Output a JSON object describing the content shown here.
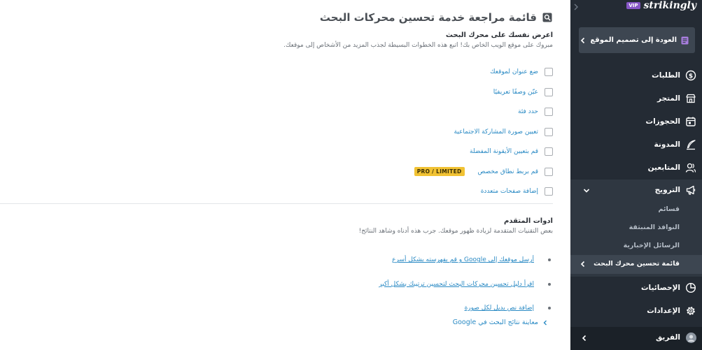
{
  "main": {
    "title": "قائمة مراجعة خدمة تحسين محركات البحث",
    "intro_heading": "اعرض نفسك على محرك البحث",
    "intro_desc": "مبروك على موقع الويب الخاص بك! اتبع هذه الخطوات البسيطة لجذب المزيد من الأشخاص إلى موقعك.",
    "checklist": [
      {
        "label": "ضع عنوان لموقعك",
        "checked": false
      },
      {
        "label": "عيّن وصفًا تعريفيًا",
        "checked": false
      },
      {
        "label": "حدد فئة",
        "checked": false
      },
      {
        "label": "تعيين صورة المشاركة الاجتماعية",
        "checked": false
      },
      {
        "label": "قم بتعيين الأيقونة المفضلة",
        "checked": false
      },
      {
        "label": "قم بربط نطاق مخصص",
        "checked": false,
        "badge": "PRO / LIMITED"
      },
      {
        "label": "إضافة صفحات متعددة",
        "checked": false
      }
    ],
    "advanced_heading": "ادوات المتقدم",
    "advanced_desc": "بعض التقنيات المتقدمة لزيادة ظهور موقعك. جرب هذه أدناه وشاهد النتائج!",
    "advanced_links": [
      "أرسل موقعك إلى Google و قم بفهرسته بشكل أسرع",
      "اقرأ دليل تحسين محركات البحث لتحسين ترتيبك بشكل أكبر",
      "إضافة نص بديل لكل صورة"
    ],
    "preview_link": "معاينة نتائج البحث في Google"
  },
  "sidebar": {
    "brand": "strikingly",
    "vip_badge": "VIP",
    "back_button": "العودة إلى تصميم الموقع",
    "nav": [
      {
        "label": "الطلبات",
        "icon": "dollar-icon"
      },
      {
        "label": "المتجر",
        "icon": "store-icon"
      },
      {
        "label": "الحجوزات",
        "icon": "calendar-icon"
      },
      {
        "label": "المدونة",
        "icon": "quill-icon"
      },
      {
        "label": "المتابعين",
        "icon": "people-icon"
      },
      {
        "label": "الترويج",
        "icon": "megaphone-icon"
      },
      {
        "label": "الإحصائيات",
        "icon": "pie-chart-icon"
      },
      {
        "label": "الإعدادات",
        "icon": "gear-icon"
      }
    ],
    "promo_sub": [
      "قسائم",
      "النوافذ المنبثقة",
      "الرسائل الإخبارية",
      "قائمة تحسين محرك البحث"
    ],
    "team": "الفريق"
  },
  "colors": {
    "sidebar_bg": "#242b34",
    "link": "#2a8ac4",
    "badge": "#f1c233",
    "vip": "#8757c7"
  }
}
